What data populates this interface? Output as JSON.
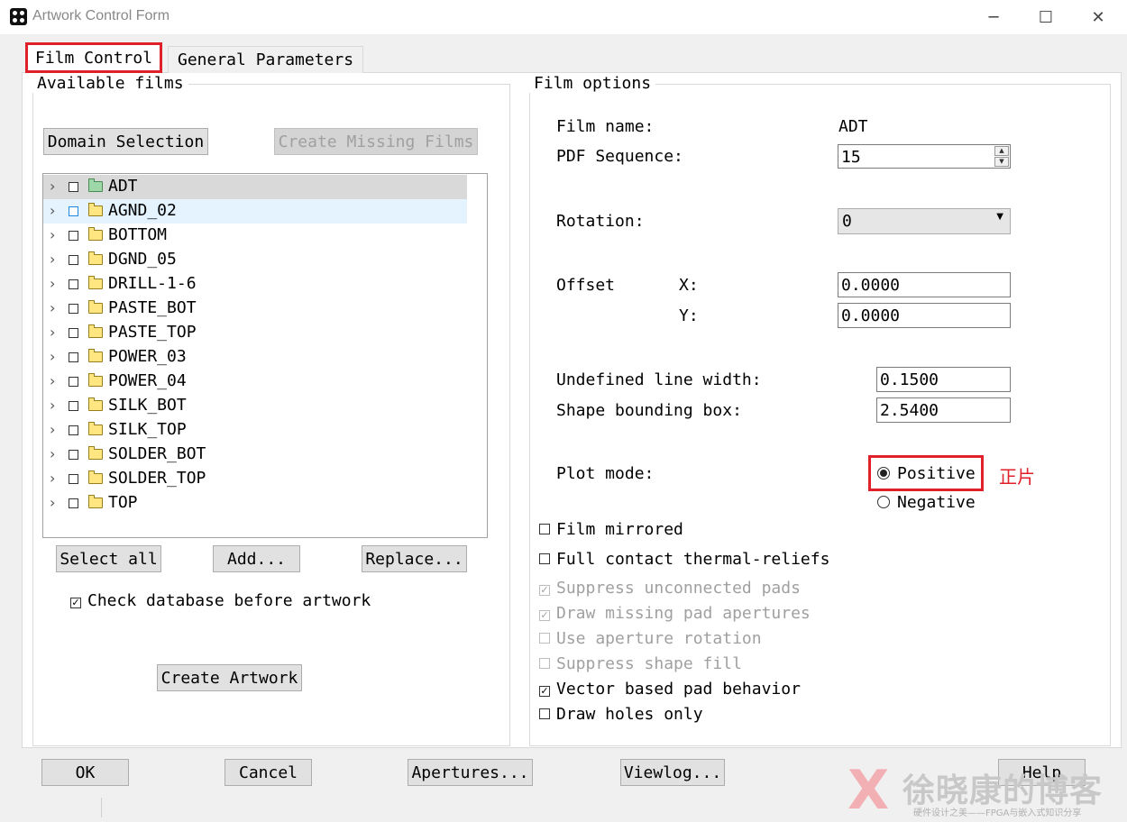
{
  "window": {
    "title": "Artwork Control Form",
    "minimize_glyph": "─",
    "maximize_glyph": "☐",
    "close_glyph": "✕"
  },
  "tabs": [
    {
      "label": "Film Control",
      "active": true
    },
    {
      "label": "General Parameters",
      "active": false
    }
  ],
  "available_films": {
    "legend": "Available films",
    "domain_selection_label": "Domain Selection",
    "create_missing_label": "Create Missing Films",
    "films": [
      "ADT",
      "AGND_02",
      "BOTTOM",
      "DGND_05",
      "DRILL-1-6",
      "PASTE_BOT",
      "PASTE_TOP",
      "POWER_03",
      "POWER_04",
      "SILK_BOT",
      "SILK_TOP",
      "SOLDER_BOT",
      "SOLDER_TOP",
      "TOP"
    ],
    "select_all_label": "Select all",
    "add_label": "Add...",
    "replace_label": "Replace...",
    "check_database_label": "Check database before artwork",
    "create_artwork_label": "Create Artwork"
  },
  "film_options": {
    "legend": "Film options",
    "film_name_label": "Film name:",
    "film_name_value": "ADT",
    "pdf_sequence_label": "PDF Sequence:",
    "pdf_sequence_value": "15",
    "rotation_label": "Rotation:",
    "rotation_value": "0",
    "offset_label": "Offset",
    "x_label": "X:",
    "x_value": "0.0000",
    "y_label": "Y:",
    "y_value": "0.0000",
    "undefined_line_width_label": "Undefined line width:",
    "undefined_line_width_value": "0.1500",
    "shape_bounding_box_label": "Shape bounding box:",
    "shape_bounding_box_value": "2.5400",
    "plot_mode_label": "Plot mode:",
    "positive_label": "Positive",
    "negative_label": "Negative",
    "annotation": "正片",
    "checks": {
      "film_mirrored": "Film mirrored",
      "full_contact": "Full contact thermal-reliefs",
      "suppress_unconnected": "Suppress unconnected pads",
      "draw_missing": "Draw missing pad apertures",
      "use_aperture_rotation": "Use aperture rotation",
      "suppress_shape_fill": "Suppress shape fill",
      "vector_based": "Vector based pad behavior",
      "draw_holes_only": "Draw holes only"
    }
  },
  "footer": {
    "ok_label": "OK",
    "cancel_label": "Cancel",
    "apertures_label": "Apertures...",
    "viewlog_label": "Viewlog...",
    "help_label": "Help"
  },
  "watermark": {
    "main": "徐晓康的博客",
    "sub": "硬件设计之美——FPGA与嵌入式知识分享"
  },
  "colors": {
    "highlight_red": "#e0202a",
    "tree_selected": "#d9d9d9",
    "tree_hover": "#e5f3ff"
  },
  "check_glyph": "✓"
}
